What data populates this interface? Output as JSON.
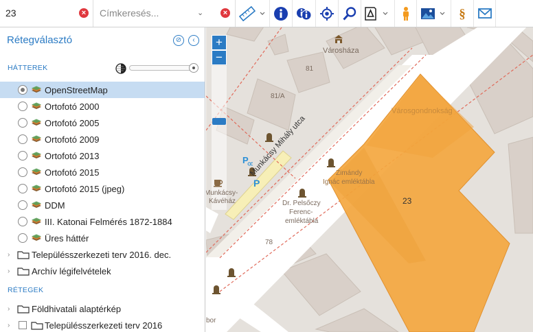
{
  "toolbar": {
    "search_value": "23",
    "tag_placeholder": "Címkeresés...",
    "icons": [
      "clear-icon",
      "chevron-down-icon",
      "clear-icon",
      "ruler-icon",
      "chevron-down-icon",
      "info-icon",
      "multi-info-icon",
      "locate-icon",
      "search-icon",
      "print-icon",
      "chevron-down-icon",
      "street-view-icon",
      "image-icon",
      "chevron-down-icon",
      "legal-icon",
      "mail-icon"
    ]
  },
  "sidebar": {
    "title": "Rétegválasztó",
    "backgrounds_label": "HÁTTEREK",
    "opacity": 0.95,
    "basemaps": [
      {
        "label": "OpenStreetMap",
        "selected": true
      },
      {
        "label": "Ortofotó 2000",
        "selected": false
      },
      {
        "label": "Ortofotó 2005",
        "selected": false
      },
      {
        "label": "Ortofotó 2009",
        "selected": false
      },
      {
        "label": "Ortofotó 2013",
        "selected": false
      },
      {
        "label": "Ortofotó 2015",
        "selected": false
      },
      {
        "label": "Ortofotó 2015 (jpeg)",
        "selected": false
      },
      {
        "label": "DDM",
        "selected": false
      },
      {
        "label": "III. Katonai Felmérés 1872-1884",
        "selected": false
      },
      {
        "label": "Üres háttér",
        "selected": false
      }
    ],
    "bg_folders": [
      "Településszerkezeti terv 2016. dec.",
      "Archív légifelvételek"
    ],
    "layers_label": "RÉTEGEK",
    "layer_folders": [
      {
        "label": "Földhivatali alaptérkép",
        "checkbox": false
      },
      {
        "label": "Településszerkezeti terv 2016",
        "checkbox": true
      }
    ]
  },
  "map": {
    "zoom_in": "+",
    "zoom_out": "−",
    "zoom_level_fraction": 0.38,
    "labels": {
      "varoshaza": "Városháza",
      "no81": "81",
      "no81a": "81/A",
      "varosgondnoksag": "Városgondnokság",
      "street": "Munkácsy Mihály utca",
      "zimandy1": "Zimándy",
      "zimandy2": "Ignác emléktábla",
      "parcel": "23",
      "pelsoczy1": "Dr. Pelsőczy",
      "pelsoczy2": "Ferenc-",
      "pelsoczy3": "emléktábla",
      "munkacsy1": "Munkácsy-",
      "munkacsy2": "Kávéház",
      "no78": "78",
      "partial": "bor"
    },
    "colors": {
      "parcel_fill": "#f4a73f",
      "road": "#ffffff",
      "background": "#e5e1dc",
      "building": "#d9d0c9",
      "pedestrian": "#f7efb7",
      "accent": "#2b7bc4"
    }
  }
}
